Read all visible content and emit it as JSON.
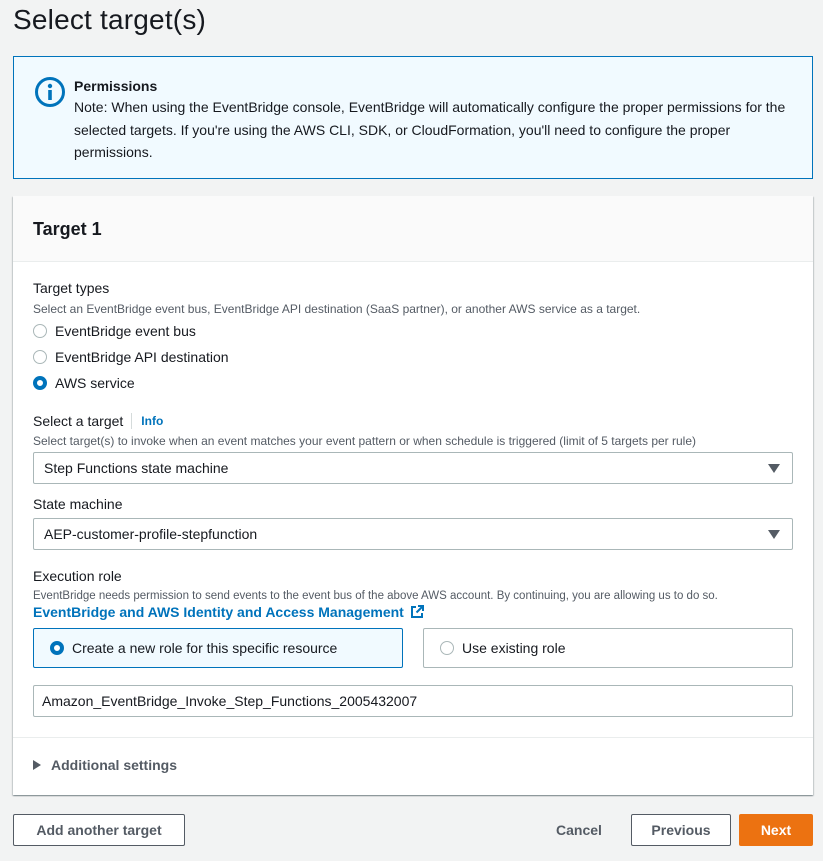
{
  "page": {
    "title": "Select target(s)"
  },
  "alert": {
    "icon": "info-icon",
    "title": "Permissions",
    "body": "Note: When using the EventBridge console, EventBridge will automatically configure the proper permissions for the selected targets. If you're using the AWS CLI, SDK, or CloudFormation, you'll need to configure the proper permissions."
  },
  "target": {
    "header": "Target 1",
    "target_types": {
      "label": "Target types",
      "description": "Select an EventBridge event bus, EventBridge API destination (SaaS partner), or another AWS service as a target.",
      "options": [
        {
          "label": "EventBridge event bus",
          "checked": false
        },
        {
          "label": "EventBridge API destination",
          "checked": false
        },
        {
          "label": "AWS service",
          "checked": true
        }
      ]
    },
    "select_target": {
      "label": "Select a target",
      "info_link": "Info",
      "description": "Select target(s) to invoke when an event matches your event pattern or when schedule is triggered (limit of 5 targets per rule)",
      "value": "Step Functions state machine"
    },
    "state_machine": {
      "label": "State machine",
      "value": "AEP-customer-profile-stepfunction"
    },
    "execution_role": {
      "label": "Execution role",
      "description": "EventBridge needs permission to send events to the event bus of the above AWS account. By continuing, you are allowing us to do so.",
      "link": "EventBridge and AWS Identity and Access Management",
      "options": [
        {
          "label": "Create a new role for this specific resource",
          "checked": true
        },
        {
          "label": "Use existing role",
          "checked": false
        }
      ],
      "role_name": "Amazon_EventBridge_Invoke_Step_Functions_2005432007"
    },
    "additional_settings": "Additional settings"
  },
  "footer": {
    "add_target": "Add another target",
    "cancel": "Cancel",
    "previous": "Previous",
    "next": "Next"
  },
  "colors": {
    "primary": "#ec7211",
    "link": "#0073bb",
    "info_bg": "#f1faff"
  }
}
